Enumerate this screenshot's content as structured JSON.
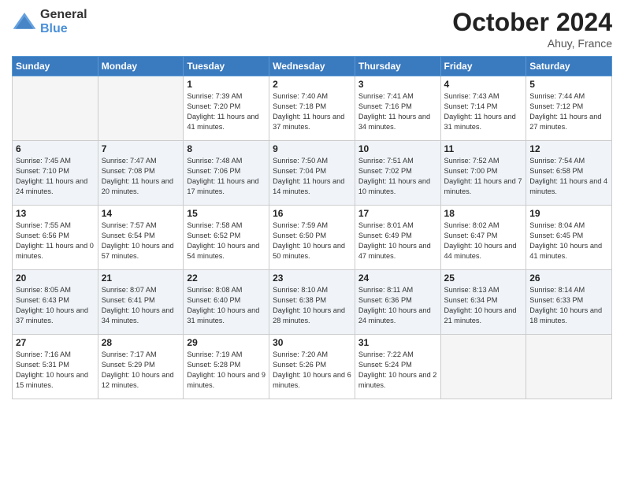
{
  "logo": {
    "general": "General",
    "blue": "Blue"
  },
  "title": "October 2024",
  "location": "Ahuy, France",
  "days_header": [
    "Sunday",
    "Monday",
    "Tuesday",
    "Wednesday",
    "Thursday",
    "Friday",
    "Saturday"
  ],
  "weeks": [
    [
      {
        "day": "",
        "info": ""
      },
      {
        "day": "",
        "info": ""
      },
      {
        "day": "1",
        "info": "Sunrise: 7:39 AM\nSunset: 7:20 PM\nDaylight: 11 hours and 41 minutes."
      },
      {
        "day": "2",
        "info": "Sunrise: 7:40 AM\nSunset: 7:18 PM\nDaylight: 11 hours and 37 minutes."
      },
      {
        "day": "3",
        "info": "Sunrise: 7:41 AM\nSunset: 7:16 PM\nDaylight: 11 hours and 34 minutes."
      },
      {
        "day": "4",
        "info": "Sunrise: 7:43 AM\nSunset: 7:14 PM\nDaylight: 11 hours and 31 minutes."
      },
      {
        "day": "5",
        "info": "Sunrise: 7:44 AM\nSunset: 7:12 PM\nDaylight: 11 hours and 27 minutes."
      }
    ],
    [
      {
        "day": "6",
        "info": "Sunrise: 7:45 AM\nSunset: 7:10 PM\nDaylight: 11 hours and 24 minutes."
      },
      {
        "day": "7",
        "info": "Sunrise: 7:47 AM\nSunset: 7:08 PM\nDaylight: 11 hours and 20 minutes."
      },
      {
        "day": "8",
        "info": "Sunrise: 7:48 AM\nSunset: 7:06 PM\nDaylight: 11 hours and 17 minutes."
      },
      {
        "day": "9",
        "info": "Sunrise: 7:50 AM\nSunset: 7:04 PM\nDaylight: 11 hours and 14 minutes."
      },
      {
        "day": "10",
        "info": "Sunrise: 7:51 AM\nSunset: 7:02 PM\nDaylight: 11 hours and 10 minutes."
      },
      {
        "day": "11",
        "info": "Sunrise: 7:52 AM\nSunset: 7:00 PM\nDaylight: 11 hours and 7 minutes."
      },
      {
        "day": "12",
        "info": "Sunrise: 7:54 AM\nSunset: 6:58 PM\nDaylight: 11 hours and 4 minutes."
      }
    ],
    [
      {
        "day": "13",
        "info": "Sunrise: 7:55 AM\nSunset: 6:56 PM\nDaylight: 11 hours and 0 minutes."
      },
      {
        "day": "14",
        "info": "Sunrise: 7:57 AM\nSunset: 6:54 PM\nDaylight: 10 hours and 57 minutes."
      },
      {
        "day": "15",
        "info": "Sunrise: 7:58 AM\nSunset: 6:52 PM\nDaylight: 10 hours and 54 minutes."
      },
      {
        "day": "16",
        "info": "Sunrise: 7:59 AM\nSunset: 6:50 PM\nDaylight: 10 hours and 50 minutes."
      },
      {
        "day": "17",
        "info": "Sunrise: 8:01 AM\nSunset: 6:49 PM\nDaylight: 10 hours and 47 minutes."
      },
      {
        "day": "18",
        "info": "Sunrise: 8:02 AM\nSunset: 6:47 PM\nDaylight: 10 hours and 44 minutes."
      },
      {
        "day": "19",
        "info": "Sunrise: 8:04 AM\nSunset: 6:45 PM\nDaylight: 10 hours and 41 minutes."
      }
    ],
    [
      {
        "day": "20",
        "info": "Sunrise: 8:05 AM\nSunset: 6:43 PM\nDaylight: 10 hours and 37 minutes."
      },
      {
        "day": "21",
        "info": "Sunrise: 8:07 AM\nSunset: 6:41 PM\nDaylight: 10 hours and 34 minutes."
      },
      {
        "day": "22",
        "info": "Sunrise: 8:08 AM\nSunset: 6:40 PM\nDaylight: 10 hours and 31 minutes."
      },
      {
        "day": "23",
        "info": "Sunrise: 8:10 AM\nSunset: 6:38 PM\nDaylight: 10 hours and 28 minutes."
      },
      {
        "day": "24",
        "info": "Sunrise: 8:11 AM\nSunset: 6:36 PM\nDaylight: 10 hours and 24 minutes."
      },
      {
        "day": "25",
        "info": "Sunrise: 8:13 AM\nSunset: 6:34 PM\nDaylight: 10 hours and 21 minutes."
      },
      {
        "day": "26",
        "info": "Sunrise: 8:14 AM\nSunset: 6:33 PM\nDaylight: 10 hours and 18 minutes."
      }
    ],
    [
      {
        "day": "27",
        "info": "Sunrise: 7:16 AM\nSunset: 5:31 PM\nDaylight: 10 hours and 15 minutes."
      },
      {
        "day": "28",
        "info": "Sunrise: 7:17 AM\nSunset: 5:29 PM\nDaylight: 10 hours and 12 minutes."
      },
      {
        "day": "29",
        "info": "Sunrise: 7:19 AM\nSunset: 5:28 PM\nDaylight: 10 hours and 9 minutes."
      },
      {
        "day": "30",
        "info": "Sunrise: 7:20 AM\nSunset: 5:26 PM\nDaylight: 10 hours and 6 minutes."
      },
      {
        "day": "31",
        "info": "Sunrise: 7:22 AM\nSunset: 5:24 PM\nDaylight: 10 hours and 2 minutes."
      },
      {
        "day": "",
        "info": ""
      },
      {
        "day": "",
        "info": ""
      }
    ]
  ]
}
